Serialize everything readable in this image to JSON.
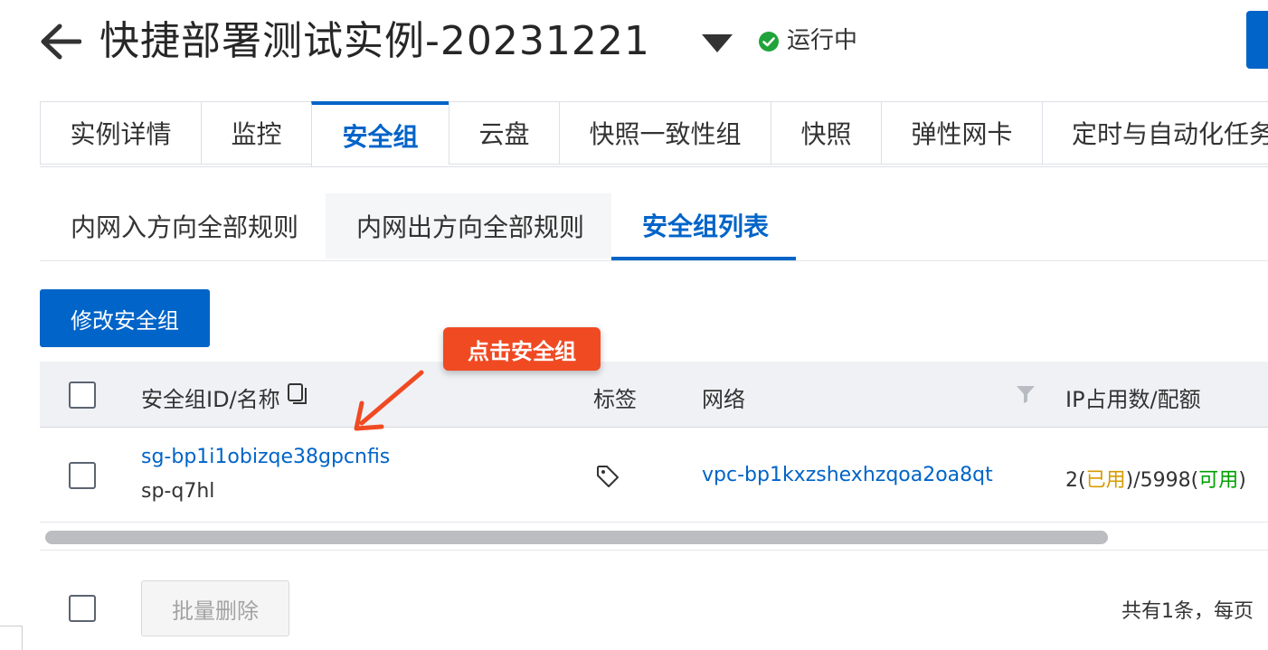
{
  "header": {
    "title": "快捷部署测试实例-20231221",
    "status": "运行中",
    "status_color": "#1fa33a",
    "icons": {
      "back": "arrow-left-icon",
      "dropdown": "caret-down-icon",
      "status": "check-circle-icon"
    }
  },
  "tabs": [
    {
      "label": "实例详情",
      "active": false
    },
    {
      "label": "监控",
      "active": false
    },
    {
      "label": "安全组",
      "active": true
    },
    {
      "label": "云盘",
      "active": false
    },
    {
      "label": "快照一致性组",
      "active": false
    },
    {
      "label": "快照",
      "active": false
    },
    {
      "label": "弹性网卡",
      "active": false
    },
    {
      "label": "定时与自动化任务",
      "active": false
    }
  ],
  "subtabs": [
    {
      "label": "内网入方向全部规则",
      "active": false
    },
    {
      "label": "内网出方向全部规则",
      "active": false
    },
    {
      "label": "安全组列表",
      "active": true
    }
  ],
  "toolbar": {
    "modify_label": "修改安全组"
  },
  "annotation": {
    "label": "点击安全组",
    "color": "#f04a23"
  },
  "table": {
    "columns": [
      "安全组ID/名称",
      "标签",
      "网络",
      "IP占用数/配额"
    ],
    "rows": [
      {
        "id": "sg-bp1i1obizqe38gpcnfis",
        "name": "sp-q7hl",
        "network": "vpc-bp1kxzshexhzqoa2oa8qt",
        "ip_prefix": "2(",
        "ip_used": "已用",
        "ip_mid": ")/5998(",
        "ip_avail": "可用",
        "ip_suffix": ")"
      }
    ]
  },
  "footer": {
    "batch_delete_label": "批量删除",
    "summary": "共有1条，每页"
  },
  "colors": {
    "primary": "#0064c8",
    "used": "#d69b00",
    "available": "#00a000"
  }
}
